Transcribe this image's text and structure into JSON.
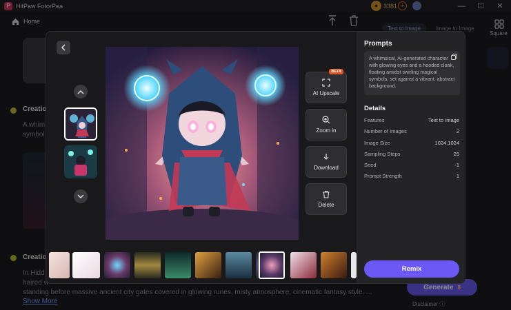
{
  "app": {
    "title": "HitPaw FotorPea",
    "coins": "3381",
    "window_controls": {
      "minimize": "—",
      "maximize": "☐",
      "close": "✕"
    }
  },
  "nav": {
    "home_label": "Home"
  },
  "background_feed": {
    "creation_1_title": "Creatio",
    "creation_1_text_line1": "A whim",
    "creation_1_text_line2": "symbol",
    "creation_2_title": "Creatio",
    "creation_2_text_line1": "In Hidd",
    "creation_2_text_line2": "haired w",
    "creation_2_text_line3": "standing before massive ancient city gates covered in glowing runes, misty atmosphere, cinematic fantasy style, ...",
    "show_more": "Show More"
  },
  "right_panel": {
    "tabs": [
      "Text to Image",
      "Image to Image"
    ],
    "square_label": "Square",
    "generate_label": "Generate",
    "generate_cost": "8",
    "disclaimer": "Disclaimer ⓘ"
  },
  "modal": {
    "actions": [
      {
        "label": "AI Upscale",
        "badge": "BETA",
        "icon": "upscale-icon"
      },
      {
        "label": "Zoom in",
        "icon": "zoom-in-icon"
      },
      {
        "label": "Download",
        "icon": "download-icon"
      },
      {
        "label": "Delete",
        "icon": "trash-icon"
      }
    ],
    "prompts_title": "Prompts",
    "prompt_text": "A whimsical, AI-generated character with glowing eyes and a hooded cloak, floating amidst swirling magical symbols, set against a vibrant, abstract background.",
    "details_title": "Details",
    "details": [
      {
        "key": "Features",
        "value": "Text to Image"
      },
      {
        "key": "Number of Images",
        "value": "2"
      },
      {
        "key": "Image Size",
        "value": "1024,1024"
      },
      {
        "key": "Sampling Steps",
        "value": "25"
      },
      {
        "key": "Seed",
        "value": "-1"
      },
      {
        "key": "Prompt Strength",
        "value": "1"
      }
    ],
    "remix_label": "Remix",
    "image_watermark": "Hitpaw"
  },
  "colors": {
    "accent": "#6b58f5",
    "coin": "#d89a2e",
    "beta": "#e0572a"
  }
}
